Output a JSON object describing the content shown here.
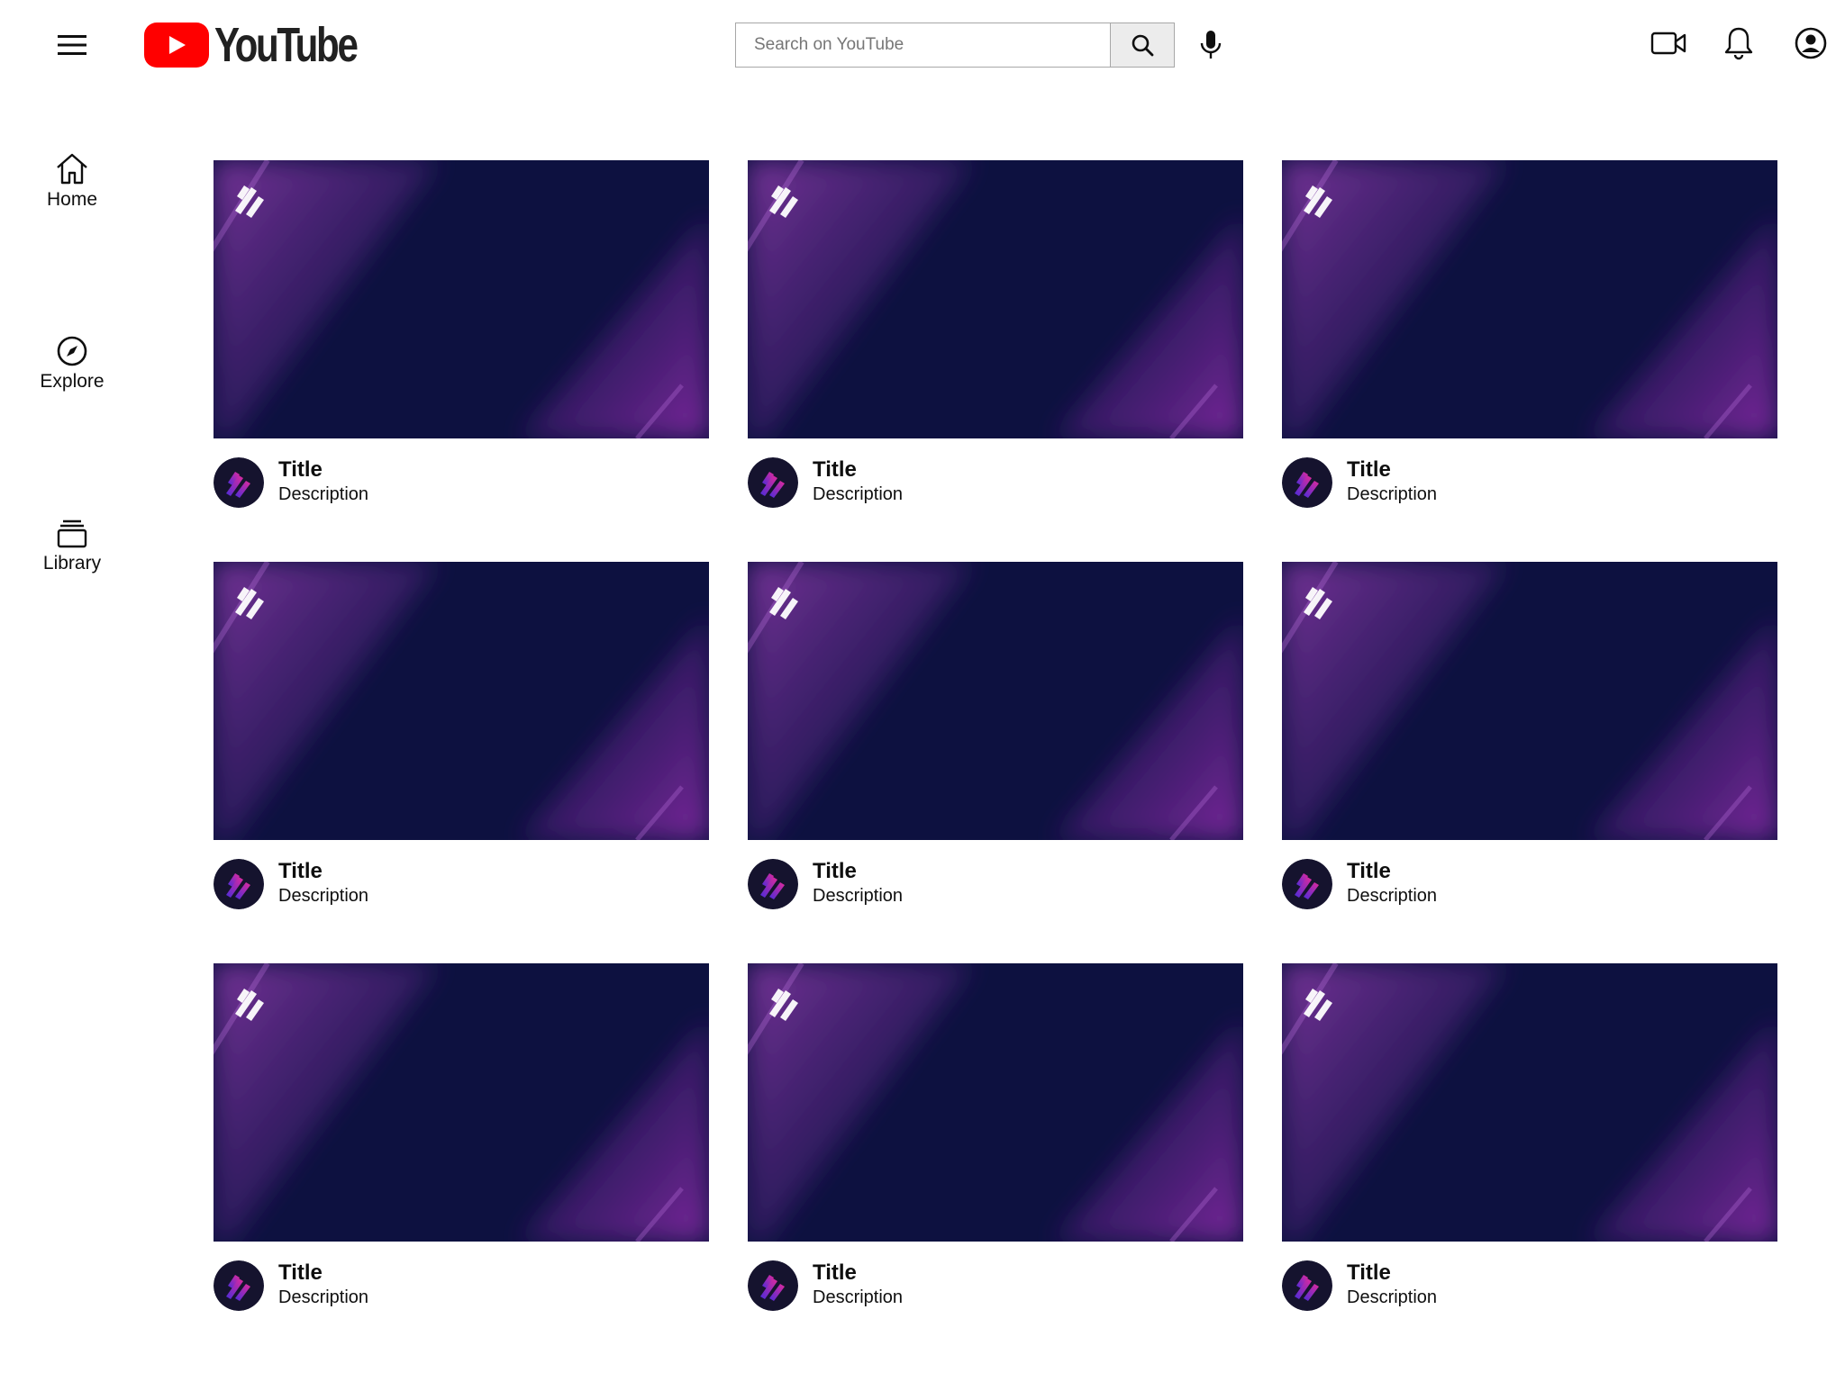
{
  "header": {
    "logo_text": "YouTube",
    "search_placeholder": "Search on YouTube",
    "icons": [
      "menu-icon",
      "search-icon",
      "mic-icon",
      "video-camera-icon",
      "bell-icon",
      "account-icon"
    ]
  },
  "sidebar": {
    "items": [
      {
        "label": "Home",
        "icon": "home-icon"
      },
      {
        "label": "Explore",
        "icon": "compass-icon"
      },
      {
        "label": "Library",
        "icon": "library-icon"
      }
    ]
  },
  "colors": {
    "brand_red": "#ff0000",
    "thumb_bg": "#0d1140",
    "thumb_accent": "#6a2690"
  },
  "videos": [
    {
      "title": "Title",
      "description": "Description"
    },
    {
      "title": "Title",
      "description": "Description"
    },
    {
      "title": "Title",
      "description": "Description"
    },
    {
      "title": "Title",
      "description": "Description"
    },
    {
      "title": "Title",
      "description": "Description"
    },
    {
      "title": "Title",
      "description": "Description"
    },
    {
      "title": "Title",
      "description": "Description"
    },
    {
      "title": "Title",
      "description": "Description"
    },
    {
      "title": "Title",
      "description": "Description"
    }
  ]
}
